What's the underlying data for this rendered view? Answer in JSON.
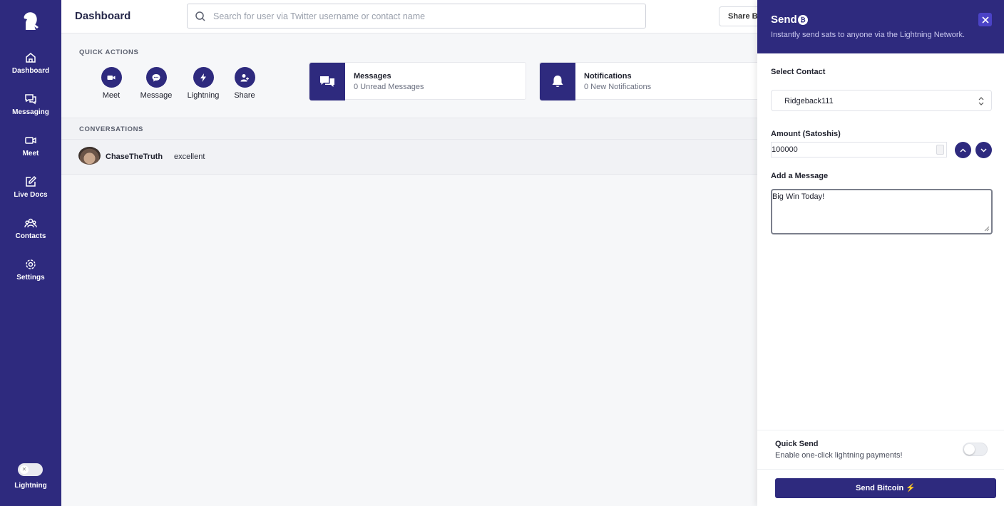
{
  "sidebar": {
    "logo": "knight-logo-icon",
    "items": [
      {
        "label": "Dashboard",
        "icon": "home-icon"
      },
      {
        "label": "Messaging",
        "icon": "chat-bubbles-icon"
      },
      {
        "label": "Meet",
        "icon": "video-camera-icon"
      },
      {
        "label": "Live Docs",
        "icon": "edit-document-icon"
      },
      {
        "label": "Contacts",
        "icon": "users-icon"
      },
      {
        "label": "Settings",
        "icon": "gear-icon"
      }
    ],
    "toggle_label": "Lightning",
    "toggle_on": false
  },
  "header": {
    "title": "Dashboard",
    "search_placeholder": "Search for user via Twitter username or contact name",
    "share_label": "Share B"
  },
  "quick_actions": {
    "title": "QUICK ACTIONS",
    "items": [
      {
        "label": "Meet",
        "icon": "video-camera-icon"
      },
      {
        "label": "Message",
        "icon": "chat-dots-icon"
      },
      {
        "label": "Lightning",
        "icon": "lightning-icon"
      },
      {
        "label": "Share",
        "icon": "user-plus-icon"
      }
    ],
    "cards": [
      {
        "title": "Messages",
        "subtitle": "0 Unread Messages",
        "icon": "chat-bubbles-icon"
      },
      {
        "title": "Notifications",
        "subtitle": "0 New Notifications",
        "icon": "bell-icon"
      }
    ]
  },
  "conversations": {
    "title": "CONVERSATIONS",
    "rows": [
      {
        "name": "ChaseTheTruth",
        "message": "excellent"
      }
    ]
  },
  "send_panel": {
    "title": "Send",
    "badge": "₿",
    "subtitle": "Instantly send sats to anyone via the Lightning Network.",
    "contact_label": "Select Contact",
    "contact_value": "Ridgeback111",
    "amount_label": "Amount (Satoshis)",
    "amount_value": "100000",
    "message_label": "Add a Message",
    "message_value": "Big Win Today!",
    "quick_send_title": "Quick Send",
    "quick_send_subtitle": "Enable one-click lightning payments!",
    "quick_send_on": false,
    "send_button": "Send Bitcoin ⚡"
  },
  "colors": {
    "brand": "#2e2a7e",
    "accent": "#4b43c7",
    "background": "#f6f7f9"
  }
}
